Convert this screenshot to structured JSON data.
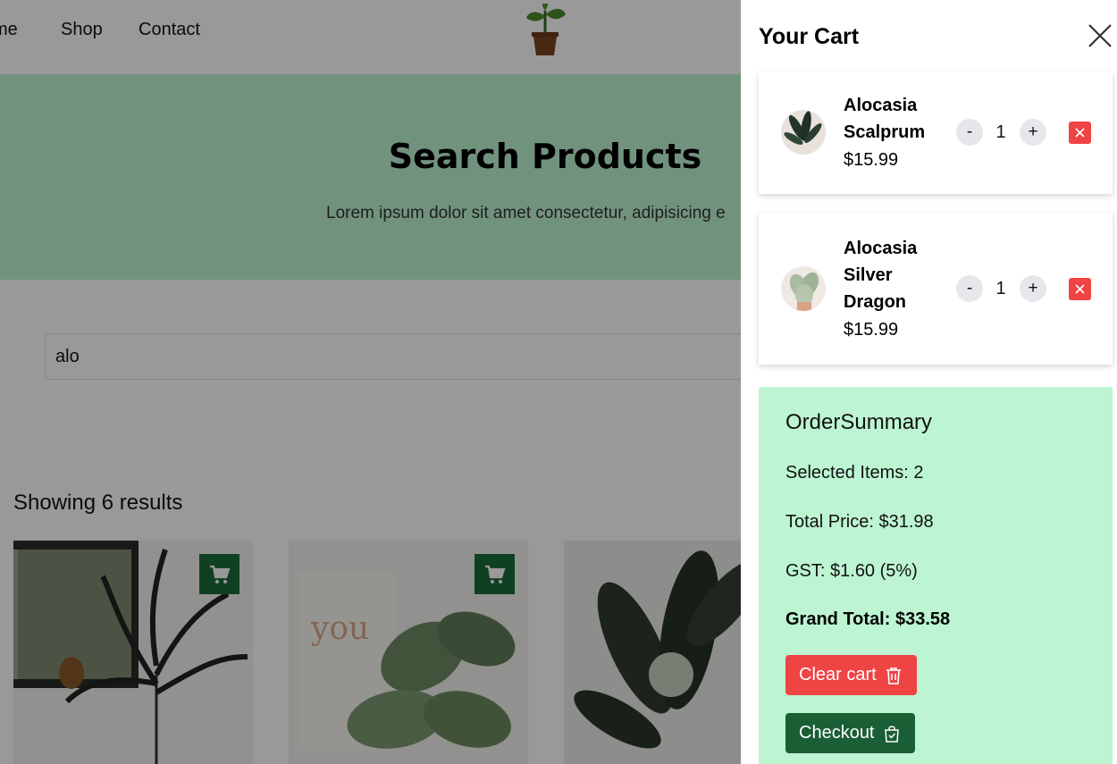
{
  "nav": {
    "links": [
      "me",
      "Shop",
      "Contact"
    ]
  },
  "hero": {
    "title": "Search Products",
    "subtitle": "Lorem ipsum dolor sit amet consectetur, adipisicing e"
  },
  "search": {
    "value": "alo"
  },
  "results": {
    "label": "Showing 6 results"
  },
  "cart": {
    "title": "Your Cart",
    "items": [
      {
        "name": "Alocasia Scalprum",
        "price": "$15.99",
        "quantity": "1"
      },
      {
        "name": "Alocasia Silver Dragon",
        "price": "$15.99",
        "quantity": "1"
      }
    ],
    "qty_minus": "-",
    "qty_plus": "+"
  },
  "summary": {
    "title": "OrderSummary",
    "selected_items": "Selected Items: 2",
    "total_price": "Total Price: $31.98",
    "gst": "GST: $1.60 (5%)",
    "grand_total": "Grand Total: $33.58",
    "clear_label": "Clear cart",
    "checkout_label": "Checkout"
  },
  "colors": {
    "brand_green": "#1a6b3a",
    "mint": "#bdf5d2",
    "danger": "#ef4444"
  },
  "icons": [
    "plant-logo-icon",
    "cart-icon",
    "close-icon",
    "remove-icon",
    "trash-icon",
    "shopping-bag-icon"
  ]
}
